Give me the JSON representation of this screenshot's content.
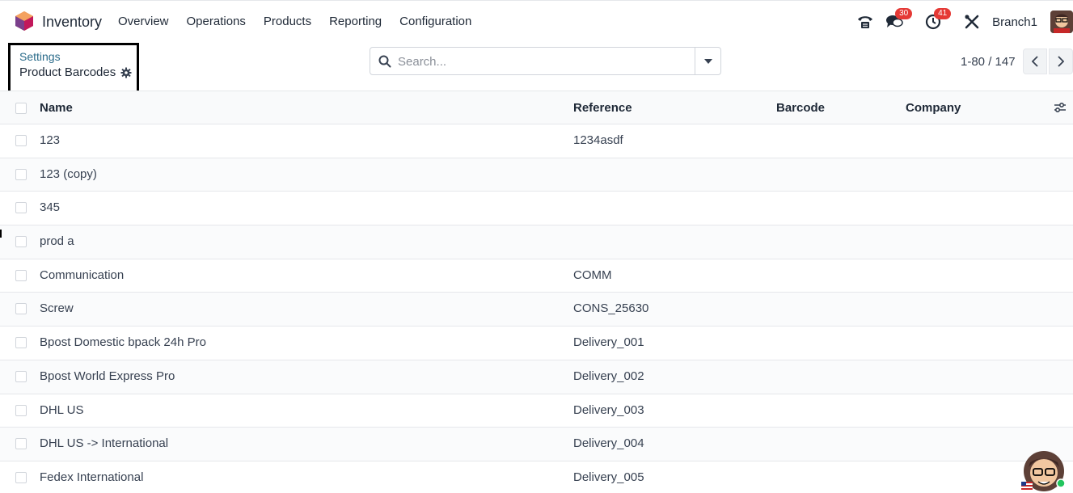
{
  "navbar": {
    "app_name": "Inventory",
    "menu": [
      "Overview",
      "Operations",
      "Products",
      "Reporting",
      "Configuration"
    ],
    "messages_count": "30",
    "activities_count": "41",
    "company": "Branch1"
  },
  "breadcrumb": {
    "parent": "Settings",
    "current": "Product Barcodes"
  },
  "search": {
    "placeholder": "Search..."
  },
  "pager": {
    "value": "1-80 / 147"
  },
  "table": {
    "columns": [
      "Name",
      "Reference",
      "Barcode",
      "Company"
    ],
    "rows": [
      {
        "name": "123",
        "reference": "1234asdf",
        "barcode": "",
        "company": ""
      },
      {
        "name": "123 (copy)",
        "reference": "",
        "barcode": "",
        "company": ""
      },
      {
        "name": "345",
        "reference": "",
        "barcode": "",
        "company": ""
      },
      {
        "name": "prod a",
        "reference": "",
        "barcode": "",
        "company": ""
      },
      {
        "name": "Communication",
        "reference": "COMM",
        "barcode": "",
        "company": ""
      },
      {
        "name": "Screw",
        "reference": "CONS_25630",
        "barcode": "",
        "company": ""
      },
      {
        "name": "Bpost Domestic bpack 24h Pro",
        "reference": "Delivery_001",
        "barcode": "",
        "company": ""
      },
      {
        "name": "Bpost World Express Pro",
        "reference": "Delivery_002",
        "barcode": "",
        "company": ""
      },
      {
        "name": "DHL US",
        "reference": "Delivery_003",
        "barcode": "",
        "company": ""
      },
      {
        "name": "DHL US -> International",
        "reference": "Delivery_004",
        "barcode": "",
        "company": ""
      },
      {
        "name": "Fedex International",
        "reference": "Delivery_005",
        "barcode": "",
        "company": ""
      }
    ]
  },
  "colors": {
    "accent": "#714B67",
    "badge": "#e53935",
    "breadcrumb_link": "#2a6b8a"
  },
  "icons": [
    "app-logo-icon",
    "phone-icon",
    "chat-icon",
    "clock-icon",
    "tools-icon",
    "gear-icon",
    "search-icon",
    "caret-down-icon",
    "chevron-left-icon",
    "chevron-right-icon",
    "sliders-icon"
  ]
}
